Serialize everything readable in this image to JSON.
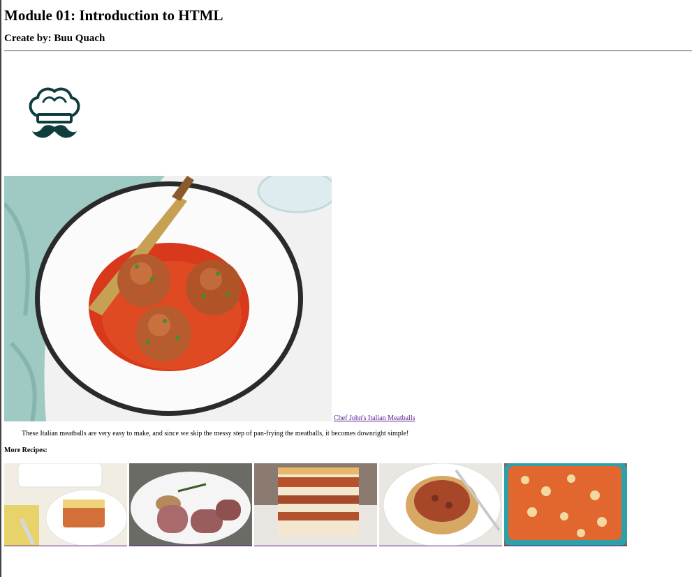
{
  "page": {
    "title": "Module 01: Introduction to HTML",
    "author": "Create by: Buu Quach"
  },
  "logo": {
    "icon": "chef-hat-mustache-icon",
    "color": "#0f3d3e"
  },
  "hero": {
    "image": "italian-meatballs-photo",
    "link_text": "Chef John's Italian Meatballs",
    "description": "These Italian meatballs are very easy to make, and since we skip the messy step of pan-frying the meatballs, it becomes downright simple!"
  },
  "more": {
    "label": "More Recipes:",
    "items": [
      {
        "image": "lasagna-plate-photo"
      },
      {
        "image": "stuffed-pork-loin-photo"
      },
      {
        "image": "lasagna-slice-photo"
      },
      {
        "image": "spaghetti-bolognese-photo"
      },
      {
        "image": "baked-ziti-photo"
      }
    ]
  },
  "colors": {
    "link": "#551a8b",
    "rule": "#9a9a9a"
  }
}
